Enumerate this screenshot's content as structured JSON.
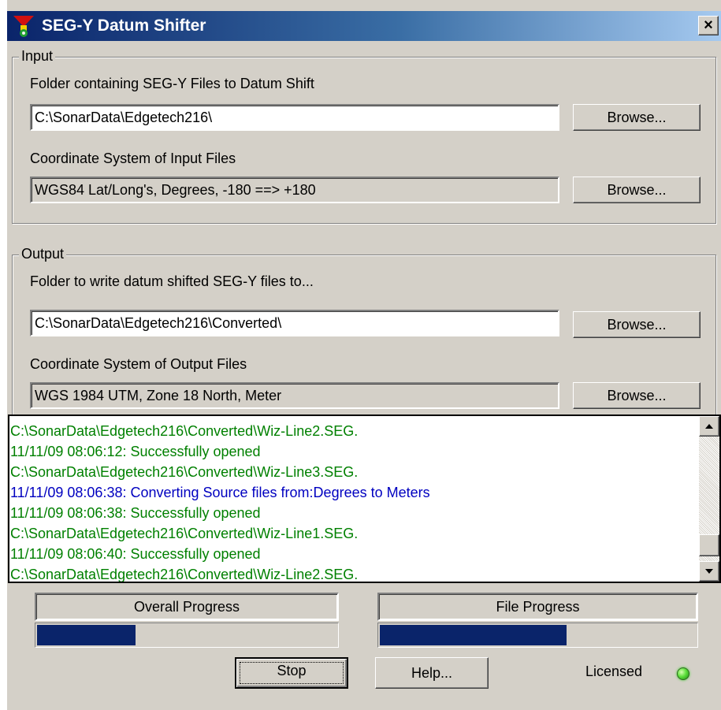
{
  "window": {
    "title": "SEG-Y Datum Shifter",
    "close_label": "×"
  },
  "input": {
    "group_label": "Input",
    "folder_label": "Folder containing SEG-Y Files to Datum Shift",
    "folder_value": "C:\\SonarData\\Edgetech216\\",
    "folder_browse": "Browse...",
    "cs_label": "Coordinate System of Input Files",
    "cs_value": "WGS84 Lat/Long's, Degrees, -180 ==> +180",
    "cs_browse": "Browse..."
  },
  "output": {
    "group_label": "Output",
    "folder_label": "Folder to write datum shifted SEG-Y files to...",
    "folder_value": "C:\\SonarData\\Edgetech216\\Converted\\",
    "folder_browse": "Browse...",
    "cs_label": "Coordinate System of Output Files",
    "cs_value": "WGS 1984 UTM, Zone 18 North, Meter",
    "cs_browse": "Browse..."
  },
  "log": {
    "lines": [
      {
        "text": "C:\\SonarData\\Edgetech216\\Converted\\Wiz-Line2.SEG.",
        "color": "#008000"
      },
      {
        "text": "11/11/09 08:06:12: Successfully opened",
        "color": "#008000"
      },
      {
        "text": "C:\\SonarData\\Edgetech216\\Converted\\Wiz-Line3.SEG.",
        "color": "#008000"
      },
      {
        "text": "11/11/09 08:06:38: Converting Source files from:Degrees to Meters",
        "color": "#0000c0"
      },
      {
        "text": "11/11/09 08:06:38: Successfully opened",
        "color": "#008000"
      },
      {
        "text": "C:\\SonarData\\Edgetech216\\Converted\\Wiz-Line1.SEG.",
        "color": "#008000"
      },
      {
        "text": "11/11/09 08:06:40: Successfully opened",
        "color": "#008000"
      },
      {
        "text": "C:\\SonarData\\Edgetech216\\Converted\\Wiz-Line2.SEG.",
        "color": "#008000"
      }
    ]
  },
  "progress": {
    "overall_label": "Overall Progress",
    "overall_fraction": 0.33,
    "file_label": "File Progress",
    "file_fraction": 0.59
  },
  "buttons": {
    "stop": "Stop",
    "help": "Help..."
  },
  "status": {
    "licensed_label": "Licensed",
    "led_color": "#3ccc2a"
  },
  "colors": {
    "title_gradient_start": "#0a246a",
    "progress_fill": "#0a246a",
    "log_green": "#008000",
    "log_blue": "#0000c0"
  }
}
